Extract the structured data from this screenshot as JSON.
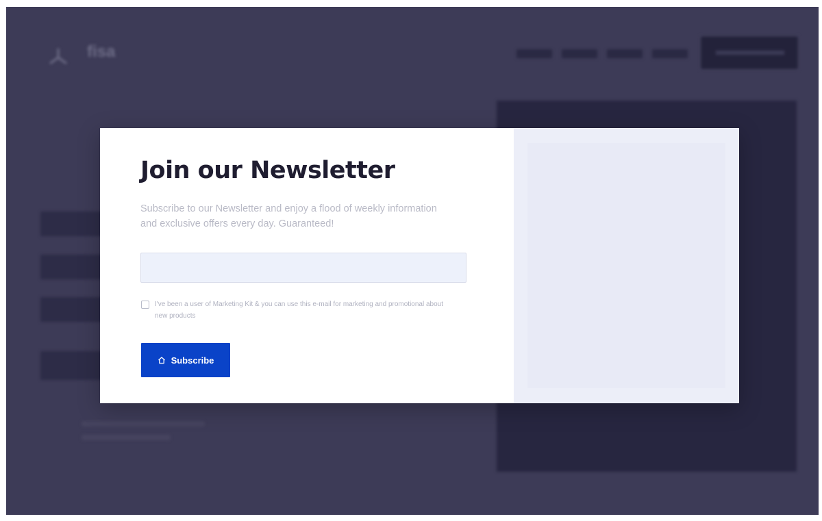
{
  "background_page": {
    "logo_text": "fisa"
  },
  "modal": {
    "title": "Join our Newsletter",
    "description": "Subscribe to our Newsletter and enjoy a flood of weekly information and exclusive offers every day. Guaranteed!",
    "email_input": {
      "value": "",
      "placeholder": ""
    },
    "consent_text": "I've been a user of Marketing Kit & you can use this e-mail for marketing and promotional about new products",
    "subscribe_label": "Subscribe",
    "subscribe_icon": "home-icon"
  },
  "colors": {
    "overlay": "#3d3b57",
    "accent": "#0a43c8",
    "input_bg": "#edf1fb",
    "side_panel": "#eceef8"
  }
}
